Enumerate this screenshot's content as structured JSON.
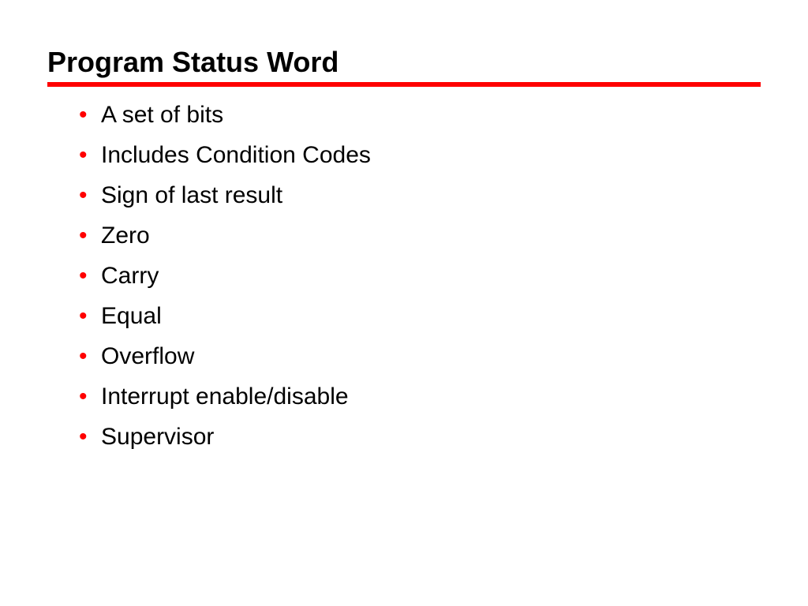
{
  "slide": {
    "title": "Program Status Word",
    "bullets": [
      "A set of bits",
      "Includes Condition Codes",
      "Sign of last result",
      "Zero",
      "Carry",
      "Equal",
      "Overflow",
      "Interrupt enable/disable",
      "Supervisor"
    ]
  }
}
